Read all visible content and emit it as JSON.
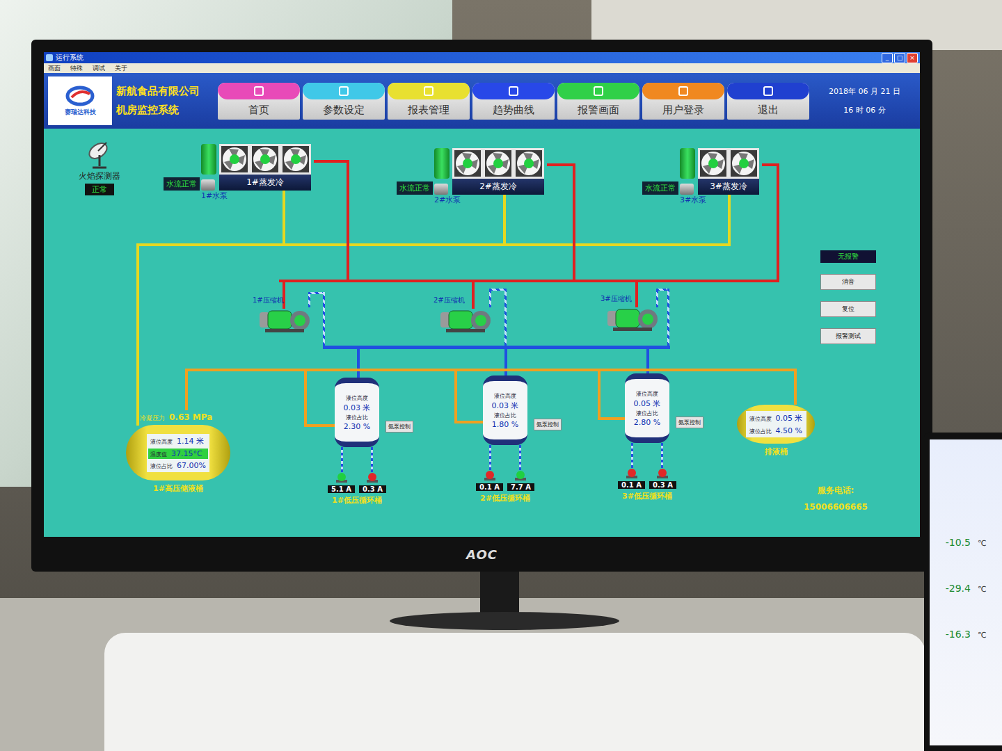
{
  "window": {
    "title": "运行系统",
    "controls": [
      "_",
      "□",
      "×"
    ]
  },
  "menu": [
    "画面",
    "特殊",
    "调试",
    "关于"
  ],
  "header": {
    "logo_text": "赛瑞达科技",
    "company": "新航食品有限公司",
    "system": "机房监控系统",
    "date": "2018年 06 月 21 日",
    "time": "16 时 06 分"
  },
  "nav": [
    {
      "label": "首页",
      "color": "#e84ab8"
    },
    {
      "label": "参数设定",
      "color": "#40c8e8"
    },
    {
      "label": "报表管理",
      "color": "#e8e030"
    },
    {
      "label": "趋势曲线",
      "color": "#2848e8"
    },
    {
      "label": "报警画面",
      "color": "#30d048"
    },
    {
      "label": "用户登录",
      "color": "#f08820"
    },
    {
      "label": "退出",
      "color": "#2040d0"
    }
  ],
  "flame_detector": {
    "label": "火焰探测器",
    "status": "正常"
  },
  "condensers": [
    {
      "name": "1#蒸发冷",
      "pump": "1#水泵",
      "flow": "水流正常",
      "fans": [
        {
          "on": true
        },
        {
          "on": true
        },
        {
          "on": true
        }
      ]
    },
    {
      "name": "2#蒸发冷",
      "pump": "2#水泵",
      "flow": "水流正常",
      "fans": [
        {
          "on": true
        },
        {
          "on": true
        },
        {
          "on": true
        }
      ]
    },
    {
      "name": "3#蒸发冷",
      "pump": "3#水泵",
      "flow": "水流正常",
      "fans": [
        {
          "on": true
        },
        {
          "on": true
        }
      ]
    }
  ],
  "compressors": [
    {
      "name": "1#压缩机",
      "running": true
    },
    {
      "name": "2#压缩机",
      "running": true
    },
    {
      "name": "3#压缩机",
      "running": true
    }
  ],
  "high_receiver": {
    "name": "1#高压储液桶",
    "pressure_label": "冷凝压力",
    "pressure": "0.63 MPa",
    "level_label": "液位高度",
    "level_value": "1.14 米",
    "temp_label": "温度值",
    "temp": "37.15°C",
    "ratio_label": "液位占比",
    "ratio": "67.00%"
  },
  "barrels": [
    {
      "name": "1#低压循环桶",
      "level_label": "液位高度",
      "level_value": "0.03 米",
      "ratio_label": "液位占比",
      "ratio": "2.30 %",
      "button": "氨泵控制",
      "pumps": [
        {
          "current": "5.1 A",
          "running": true
        },
        {
          "current": "0.3 A",
          "running": false
        }
      ]
    },
    {
      "name": "2#低压循环桶",
      "level_label": "液位高度",
      "level_value": "0.03 米",
      "ratio_label": "液位占比",
      "ratio": "1.80 %",
      "button": "氨泵控制",
      "pumps": [
        {
          "current": "0.1 A",
          "running": false
        },
        {
          "current": "7.7 A",
          "running": true
        }
      ]
    },
    {
      "name": "3#低压循环桶",
      "level_label": "液位高度",
      "level_value": "0.05 米",
      "ratio_label": "液位占比",
      "ratio": "2.80 %",
      "button": "氨泵控制",
      "pumps": [
        {
          "current": "0.1 A",
          "running": false
        },
        {
          "current": "0.3 A",
          "running": false
        }
      ]
    }
  ],
  "drain": {
    "name": "排液桶",
    "level_label": "液位高度",
    "level_value": "0.05 米",
    "ratio_label": "液位占比",
    "ratio": "4.50 %"
  },
  "alarm": {
    "status": "无报警",
    "buttons": [
      "消音",
      "复位",
      "报警测试"
    ]
  },
  "service": {
    "label": "服务电话:",
    "phone": "15006606665"
  },
  "monitor": {
    "brand": "AOC"
  },
  "second_monitor": {
    "readings": [
      {
        "value": "-10.5",
        "unit": "℃"
      },
      {
        "value": "-29.4",
        "unit": "℃"
      },
      {
        "value": "-16.3",
        "unit": "℃"
      }
    ]
  }
}
